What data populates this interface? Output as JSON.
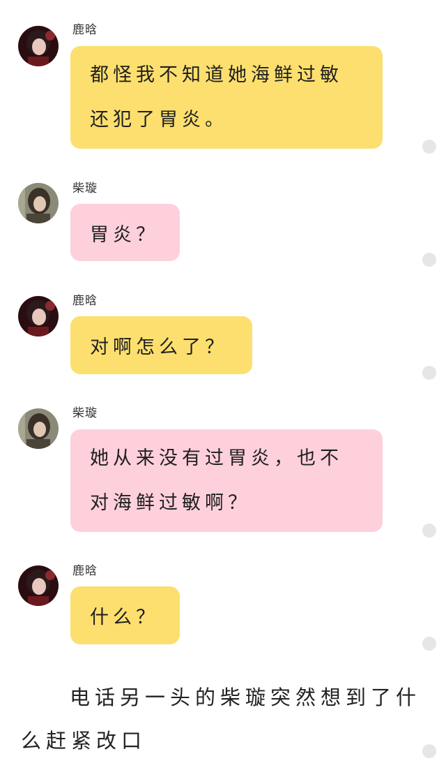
{
  "messages": [
    {
      "sender": "鹿晗",
      "text": "都怪我不知道她海鲜过敏\n还犯了胃炎。",
      "bubble_color": "#fcdf6e"
    },
    {
      "sender": "柴璇",
      "text": "胃炎？",
      "bubble_color": "#fdd0dc"
    },
    {
      "sender": "鹿晗",
      "text": "对啊怎么了？",
      "bubble_color": "#fcdf6e"
    },
    {
      "sender": "柴璇",
      "text": "她从来没有过胃炎，也不\n对海鲜过敏啊？",
      "bubble_color": "#fdd0dc"
    },
    {
      "sender": "鹿晗",
      "text": "什么？",
      "bubble_color": "#fcdf6e"
    }
  ],
  "narration": {
    "line1": "电话另一头的柴璇突然想到了什",
    "line2": "么赶紧改口"
  },
  "colors": {
    "yellow_bubble": "#fcdf6e",
    "pink_bubble": "#fdd0dc",
    "dot": "#e6e6e6",
    "background": "#ffffff"
  },
  "icons": {
    "avatar_luhan": "avatar-luhan-icon",
    "avatar_chaixuan": "avatar-chaixuan-icon",
    "more_dot": "more-dot-icon"
  }
}
